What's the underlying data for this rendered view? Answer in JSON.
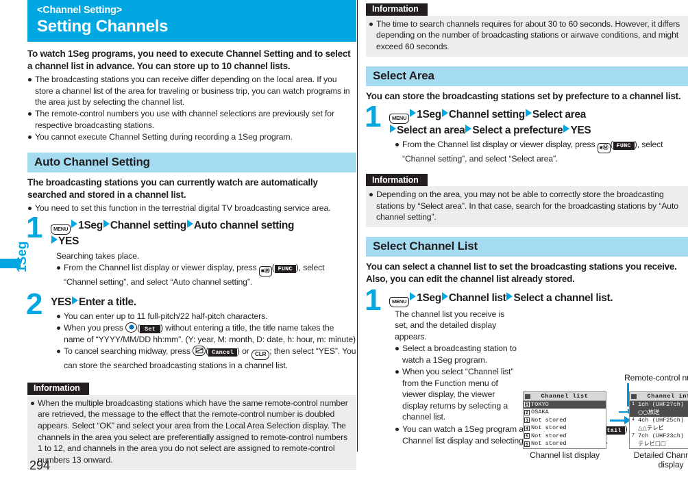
{
  "page": {
    "number": "294",
    "thumb_tab": "1Seg"
  },
  "title": {
    "subtitle": "<Channel Setting>",
    "heading": "Setting Channels"
  },
  "colors": {
    "accent": "#00a7e1",
    "section_header": "#a5dcf2",
    "info_bg": "#eceded",
    "tag_bg": "#231f20"
  },
  "intro": {
    "lead": "To watch 1Seg programs, you need to execute Channel Setting and to select a channel list in advance. You can store up to 10 channel lists.",
    "bullets": [
      "The broadcasting stations you can receive differ depending on the local area. If you store a channel list of the area for traveling or business trip, you can watch programs in the area just by selecting the channel list.",
      "The remote-control numbers you use with channel selections are previously set for respective broadcasting stations.",
      "You cannot execute Channel Setting during recording a 1Seg program."
    ]
  },
  "sections": {
    "auto_channel_setting": {
      "header": "Auto Channel Setting",
      "lead": "The broadcasting stations you can currently watch are automatically searched and stored in a channel list.",
      "bullets": [
        "You need to set this function in the terrestrial digital TV broadcasting service area."
      ],
      "step1": {
        "num": "1",
        "key_menu": "MENU",
        "path": [
          "1Seg",
          "Channel setting",
          "Auto channel setting",
          "YES"
        ],
        "result": "Searching takes place.",
        "note_pre": "From the Channel list display or viewer display, press",
        "note_key": "FUNC",
        "note_post": "), select “Channel setting”, and select “Auto channel setting”."
      },
      "step2": {
        "num": "2",
        "headline_a": "YES",
        "headline_b": "Enter a title.",
        "b1": "You can enter up to 11 full-pitch/22 half-pitch characters.",
        "b2_pre": "When you press",
        "b2_key": "Set",
        "b2_post": ") without entering a title, the title name takes the name of “YYYY/MM/DD hh:mm”. (Y: year, M: month, D: date, h: hour, m: minute)",
        "b3_pre": "To cancel searching midway, press",
        "b3_key": "Cancel",
        "b3_mid": ") or",
        "b3_key2": "CLR",
        "b3_post": "; then select “YES”. You can store the searched broadcasting stations in a channel list."
      },
      "info": {
        "tag": "Information",
        "bullets": [
          "When the multiple broadcasting stations which have the same remote-control number are retrieved, the message to the effect that the remote-control number is doubled appears. Select “OK” and select your area from the Local Area Selection display. The channels in the area you select are preferentially assigned to remote-control numbers 1 to 12, and channels in the area you do not select are assigned to remote-control numbers 13 onward."
        ]
      }
    },
    "top_right_info": {
      "tag": "Information",
      "bullets": [
        "The time to search channels requires for about 30 to 60 seconds. However, it differs depending on the number of broadcasting stations or airwave conditions, and might exceed 60 seconds."
      ]
    },
    "select_area": {
      "header": "Select Area",
      "lead": "You can store the broadcasting stations set by prefecture to a channel list.",
      "step1": {
        "num": "1",
        "key_menu": "MENU",
        "path_line1": [
          "1Seg",
          "Channel setting",
          "Select area"
        ],
        "path_line2": [
          "Select an area",
          "Select a prefecture",
          "YES"
        ],
        "note_pre": "From the Channel list display or viewer display, press",
        "note_key": "FUNC",
        "note_post": "), select “Channel setting”, and select “Select area”."
      },
      "info": {
        "tag": "Information",
        "bullets": [
          "Depending on the area, you may not be able to correctly store the broadcasting stations by “Select area”. In that case, search for the broadcasting stations by “Auto channel setting”."
        ]
      }
    },
    "select_channel_list": {
      "header": "Select Channel List",
      "lead": "You can select a channel list to set the broadcasting stations you receive. Also, you can edit the channel list already stored.",
      "step1": {
        "num": "1",
        "key_menu": "MENU",
        "path": [
          "1Seg",
          "Channel list",
          "Select a channel list."
        ],
        "result": "The channel list you receive is set, and the detailed display appears.",
        "b1": "Select a broadcasting station to watch a 1Seg program.",
        "b2": "When you select “Channel list” from the Function menu of viewer display, the viewer display returns by selecting a channel list.",
        "b3_pre": "You can watch a 1Seg program also by pressing",
        "b3_key": "Detail",
        "b3_post": ") from the Channel list display and selecting a broadcasting station."
      },
      "callout": "Remote-control number",
      "screens": {
        "channel_list": {
          "titlebar": "Channel list",
          "caption": "Channel list display",
          "rows": [
            {
              "num": "1",
              "text": "TOKYO",
              "selected": true
            },
            {
              "num": "2",
              "text": "OSAKA",
              "selected": false
            },
            {
              "num": "3",
              "text": "Not stored",
              "selected": false
            },
            {
              "num": "4",
              "text": "Not stored",
              "selected": false
            },
            {
              "num": "5",
              "text": "Not stored",
              "selected": false
            },
            {
              "num": "6",
              "text": "Not stored",
              "selected": false
            }
          ]
        },
        "channel_info": {
          "titlebar": "Channel info",
          "caption_line1": "Detailed Channel list",
          "caption_line2": "display",
          "entries": [
            {
              "num": "1",
              "channel": "1ch (UHF27ch)",
              "station": "○○放送",
              "selected": true
            },
            {
              "num": "4",
              "channel": "4ch (UHF25ch)",
              "station": "△△テレビ",
              "selected": false
            },
            {
              "num": "7",
              "channel": "7ch (UHF23ch)",
              "station": "テレビ□□",
              "selected": false
            }
          ]
        }
      }
    }
  }
}
